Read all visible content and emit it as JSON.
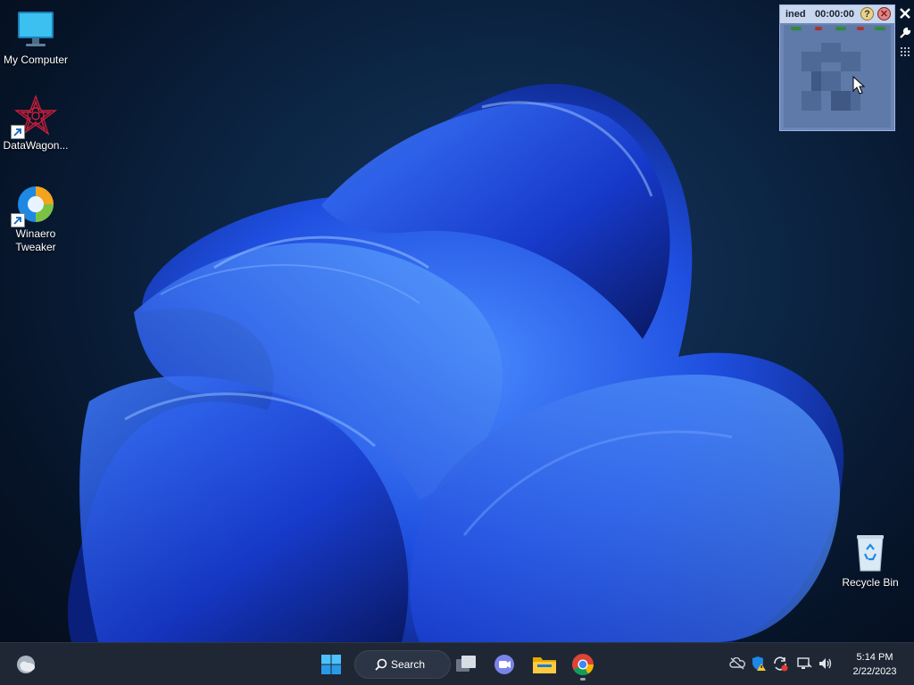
{
  "desktop": {
    "icons": [
      {
        "label": "My Computer",
        "icon": "monitor-icon"
      },
      {
        "label": "DataWagon...",
        "icon": "datawagon-icon"
      },
      {
        "label": "Winaero Tweaker",
        "icon": "winaero-tweaker-icon"
      },
      {
        "label": "Recycle Bin",
        "icon": "recycle-bin-icon"
      }
    ]
  },
  "recorder": {
    "name": "ined",
    "timer": "00:00:00",
    "help_label": "?",
    "stop_label": "✕",
    "side_tools": [
      "close-icon",
      "wrench-icon",
      "grid-icon"
    ]
  },
  "taskbar": {
    "search_label": "Search",
    "pinned": [
      "weather-icon",
      "start-icon",
      "task-view-icon",
      "teams-icon",
      "file-explorer-icon",
      "chrome-icon"
    ],
    "tray": [
      "onedrive-icon",
      "defender-warning-icon",
      "update-sync-icon",
      "network-icon",
      "volume-icon"
    ],
    "clock": {
      "time": "5:14 PM",
      "date": "2/22/2023"
    }
  },
  "colors": {
    "taskbar": "#1f2734",
    "accent": "#2b66ff",
    "wallpaper_bg": "#0c2544"
  }
}
